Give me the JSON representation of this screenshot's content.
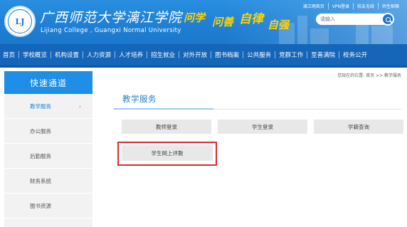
{
  "header": {
    "school_name_cn": "广西师范大学漓江学院",
    "school_name_en": "Lijiang College , Guangxi Normal University",
    "logo_text": "LJ",
    "motto": [
      "问学",
      "问善",
      "自律",
      "自强"
    ],
    "top_links": [
      "漓江网首页",
      "VPN登录",
      "校友无线",
      "师生邮箱"
    ],
    "search": {
      "placeholder": "请输入"
    }
  },
  "nav": {
    "items": [
      "首页",
      "学校概览",
      "机构设置",
      "人力资源",
      "人才培养",
      "招生就业",
      "对外开放",
      "图书档案",
      "公共服务",
      "党群工作",
      "至善满院",
      "校务公开"
    ]
  },
  "sidebar": {
    "title": "快速通道",
    "items": [
      {
        "label": "教学服务",
        "active": true
      },
      {
        "label": "办公服务",
        "active": false
      },
      {
        "label": "后勤服务",
        "active": false
      },
      {
        "label": "财务系统",
        "active": false
      },
      {
        "label": "图书资源",
        "active": false
      }
    ]
  },
  "breadcrumb": "您现在的位置: 首页 >> 教学服务",
  "main": {
    "section_title": "教学服务",
    "buttons": [
      "教师登录",
      "学生登录",
      "学籍查询",
      "学生网上评教"
    ]
  },
  "colors": {
    "header_blue": "#1e7fd4",
    "nav_blue": "#1565b8",
    "accent_yellow": "#ffd400",
    "highlight_red": "#e0282e"
  }
}
